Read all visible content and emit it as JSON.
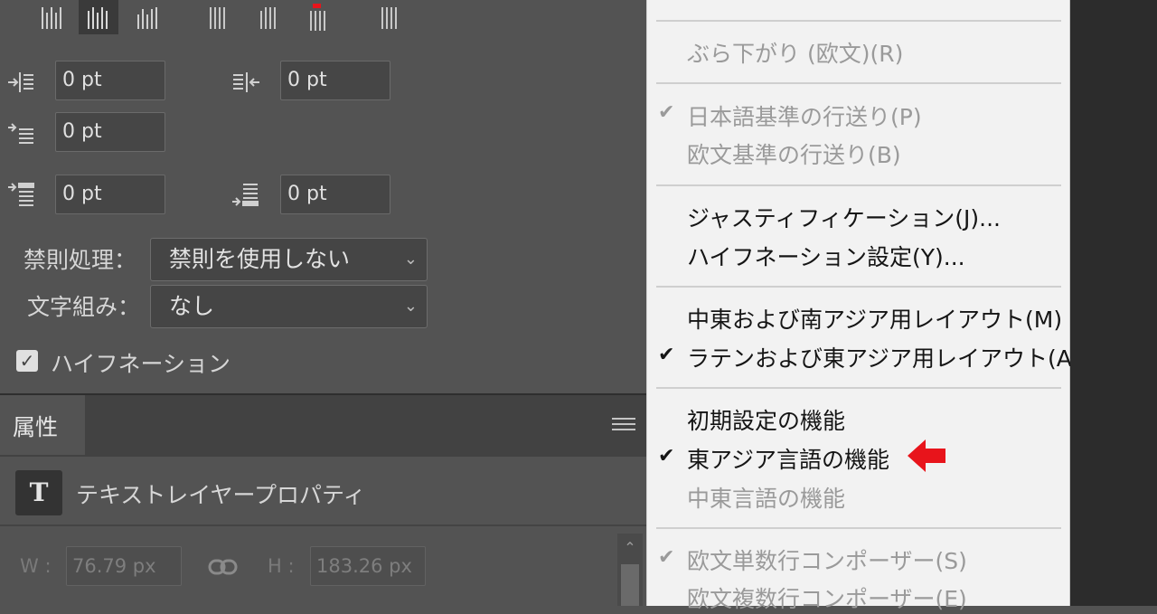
{
  "paragraph": {
    "indent_left": "0 pt",
    "indent_right": "0 pt",
    "indent_first": "0 pt",
    "space_before": "0 pt",
    "space_after": "0 pt",
    "kinsoku_label": "禁則処理：",
    "kinsoku_value": "禁則を使用しない",
    "mojikumi_label": "文字組み：",
    "mojikumi_value": "なし",
    "hyphenation_label": "ハイフネーション",
    "hyphenation_checked": true
  },
  "properties": {
    "tab_label": "属性",
    "layer_type": "テキストレイヤープロパティ",
    "type_icon": "T",
    "w_label": "W :",
    "w_value": "76.79 px",
    "h_label": "H :",
    "h_value": "183.26 px"
  },
  "menu": {
    "items": [
      {
        "label": "ぶら下がり (欧文)(R)",
        "enabled": false,
        "checked": false
      },
      {
        "label": "日本語基準の行送り(P)",
        "enabled": false,
        "checked": true
      },
      {
        "label": "欧文基準の行送り(B)",
        "enabled": false,
        "checked": false
      },
      {
        "label": "ジャスティフィケーション(J)...",
        "enabled": true,
        "checked": false
      },
      {
        "label": "ハイフネーション設定(Y)...",
        "enabled": true,
        "checked": false
      },
      {
        "label": "中東および南アジア用レイアウト(M)",
        "enabled": true,
        "checked": false
      },
      {
        "label": "ラテンおよび東アジア用レイアウト(A)",
        "enabled": true,
        "checked": true
      },
      {
        "label": "初期設定の機能",
        "enabled": true,
        "checked": false
      },
      {
        "label": "東アジア言語の機能",
        "enabled": true,
        "checked": true
      },
      {
        "label": "中東言語の機能",
        "enabled": false,
        "checked": false
      },
      {
        "label": "欧文単数行コンポーザー(S)",
        "enabled": false,
        "checked": true
      },
      {
        "label": "欧文複数行コンポーザー(E)",
        "enabled": false,
        "checked": false
      }
    ],
    "check_glyph": "✔"
  },
  "colors": {
    "annotation_arrow": "#e8141b",
    "menu_background": "#f2f2f2",
    "panel_background": "#535353"
  },
  "icons": {
    "annotation": "red-left-arrow-icon",
    "panel_menu": "hamburger-icon",
    "link": "chain-link-icon",
    "dropdown": "chevron-down-icon"
  }
}
